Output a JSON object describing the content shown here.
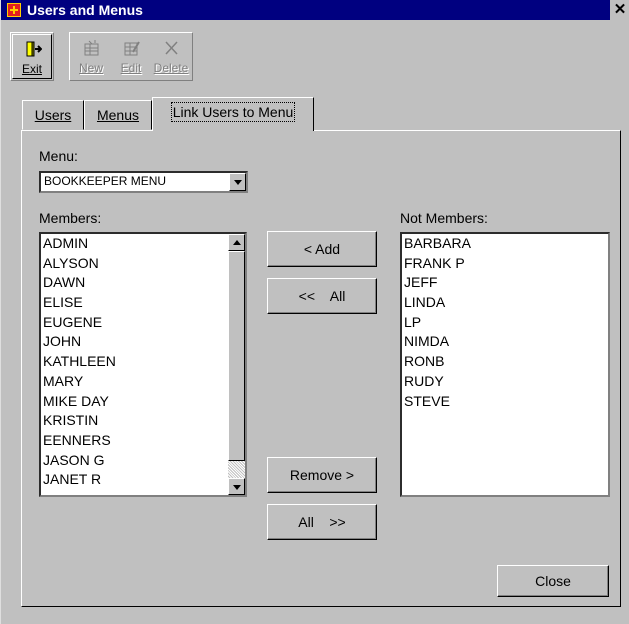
{
  "window": {
    "title": "Users and Menus",
    "close_glyph": "✕"
  },
  "toolbar": {
    "exit_label": "Exit",
    "new_label": "New",
    "edit_label": "Edit",
    "delete_label": "Delete"
  },
  "tabs": [
    {
      "label": "Users"
    },
    {
      "label": "Menus"
    },
    {
      "label": "Link Users to Menu",
      "active": true
    }
  ],
  "menu": {
    "label": "Menu:",
    "value": "BOOKKEEPER MENU"
  },
  "members": {
    "label": "Members:",
    "items": [
      "ADMIN",
      "ALYSON",
      "DAWN",
      "ELISE",
      "EUGENE",
      "JOHN",
      "KATHLEEN",
      "MARY",
      "MIKE DAY",
      "KRISTIN",
      "EENNERS",
      "JASON G",
      "JANET R"
    ]
  },
  "not_members": {
    "label": "Not Members:",
    "items": [
      "BARBARA",
      "FRANK P",
      "JEFF",
      "LINDA",
      "LP",
      "NIMDA",
      "RONB",
      "RUDY",
      "STEVE"
    ]
  },
  "buttons": {
    "add": "< Add",
    "add_all": "<<    All",
    "remove": "Remove >",
    "remove_all": "All    >>",
    "close": "Close"
  },
  "colors": {
    "titlebar": "#000080",
    "face": "#c0c0c0"
  }
}
